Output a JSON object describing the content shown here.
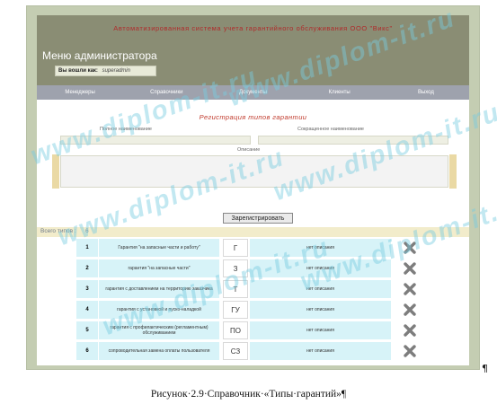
{
  "header": {
    "system_title": "Автоматизированная система учета гарантийного обслуживания ООО \"Викс\"",
    "page_title": "Меню администратора",
    "login_label": "Вы вошли как:",
    "login_user": "superadmin"
  },
  "nav": {
    "items": [
      {
        "label": "Менеджеры"
      },
      {
        "label": "Справочники"
      },
      {
        "label": "Документы"
      },
      {
        "label": "Клиенты"
      },
      {
        "label": "Выход"
      }
    ]
  },
  "form": {
    "title": "Регистрация типов гарантии",
    "full_name_label": "Полное наименование",
    "short_name_label": "Сокращенное наименование",
    "description_label": "Описание",
    "full_name_value": "",
    "short_name_value": "",
    "description_value": "",
    "register_button": "Зарегистрировать"
  },
  "list": {
    "total_label": "Всего типов :",
    "total_count": "6",
    "rows": [
      {
        "num": "1",
        "name": "Гарантия \"на запасные части и работу\"",
        "short": "Г",
        "description": "нет описания"
      },
      {
        "num": "2",
        "name": "гарантия \"на запасные части\"",
        "short": "З",
        "description": "нет описания"
      },
      {
        "num": "3",
        "name": "гарантия с доставлением на территорию заказчика",
        "short": "Т",
        "description": "нет описания"
      },
      {
        "num": "4",
        "name": "гарантия с установкой и пуско-наладкой",
        "short": "ГУ",
        "description": "нет описания"
      },
      {
        "num": "5",
        "name": "гарантия с профилактическим (регламентным) обслуживанием",
        "short": "ПО",
        "description": "нет описания"
      },
      {
        "num": "6",
        "name": "сопроводительная замена оплаты пользователя",
        "short": "СЗ",
        "description": "нет описания"
      }
    ],
    "delete_icon": "delete-x-icon"
  },
  "document": {
    "caption": "Рисунок·2.9·Справочник·«Типы·гарантий»¶",
    "pilcrow": "¶"
  },
  "watermark": {
    "text": "www.diplom-it.ru"
  },
  "colors": {
    "frame": "#c4cdb2",
    "header": "#8a8d74",
    "nav": "#9ea2ad",
    "cell": "#d7f3f8",
    "list_bar": "#f2eccb",
    "accent_red": "#c0392b",
    "watermark": "#78cde1"
  }
}
